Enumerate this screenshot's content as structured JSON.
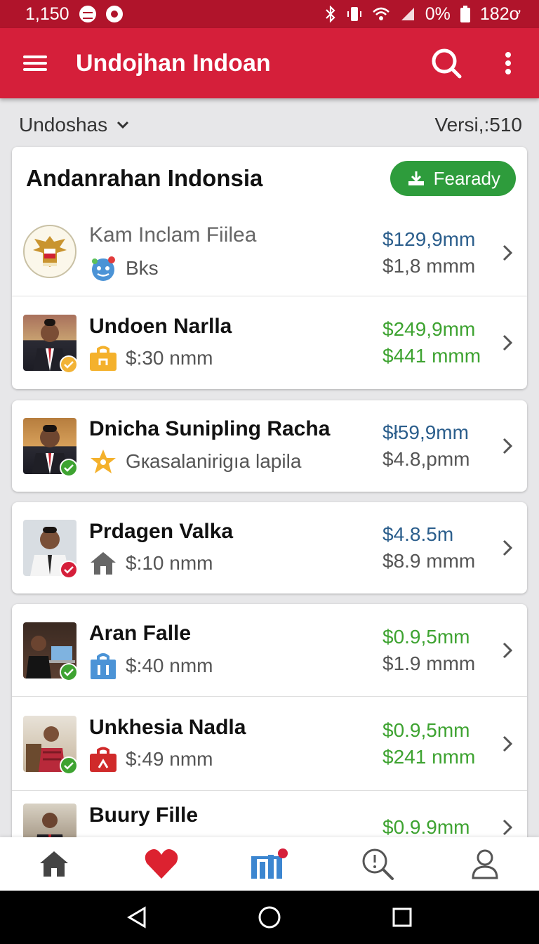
{
  "status": {
    "time": "1,150",
    "battery_pct": "0%",
    "battery_val": "182ơ"
  },
  "appbar": {
    "title": "Undojhan Indoan"
  },
  "filter": {
    "label": "Undoshas",
    "version": "Versi,:510"
  },
  "section": {
    "title": "Andanrahan Indonsia",
    "action_label": "Fearady"
  },
  "rows": [
    {
      "name": "Kam Inclam Fiilea",
      "sub": "Bks",
      "price1": "$129,9mm",
      "price2": "$1,8 mmm",
      "price1_color": "blue",
      "price2_color": "grey"
    },
    {
      "name": "Undoen Narlla",
      "sub": "$:30 nmm",
      "price1": "$249,9mm",
      "price2": "$441 mmm",
      "price1_color": "green",
      "price2_color": "green"
    },
    {
      "name": "Dnicha Sunipling Racha",
      "sub": "Gкasalanirigıa lapila",
      "price1": "$ł59,9mm",
      "price2": "$4.8,pmm",
      "price1_color": "blue",
      "price2_color": "grey"
    },
    {
      "name": "Prdagen Valka",
      "sub": "$:10 nmm",
      "price1": "$4.8.5m",
      "price2": "$8.9 mmm",
      "price1_color": "blue",
      "price2_color": "grey"
    },
    {
      "name": "Aran Falle",
      "sub": "$:40 nmm",
      "price1": "$0.9,5mm",
      "price2": "$1.9 mmm",
      "price1_color": "green",
      "price2_color": "grey"
    },
    {
      "name": "Unkhesia Nadla",
      "sub": "$:49 nmm",
      "price1": "$0.9,5mm",
      "price2": "$241 nmm",
      "price1_color": "green",
      "price2_color": "green"
    },
    {
      "name": "Buury Fille",
      "sub": "",
      "price1": "$0.9.9mm",
      "price2": "",
      "price1_color": "green",
      "price2_color": "grey"
    }
  ],
  "colors": {
    "primary": "#d51f3a",
    "statusbar": "#b0142b",
    "green": "#2e9c3c",
    "blue_price": "#2b5e8c",
    "green_price": "#3ea331"
  }
}
